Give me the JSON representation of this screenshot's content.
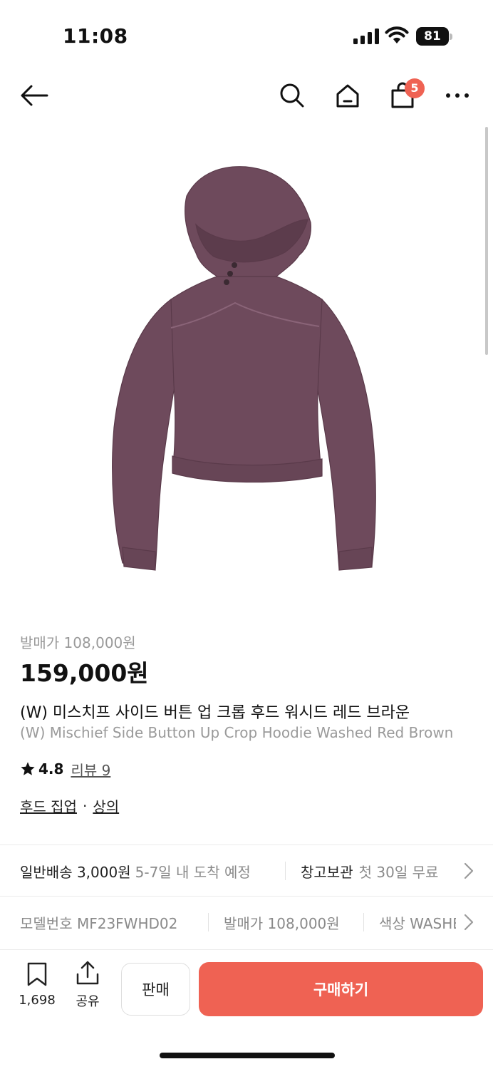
{
  "status": {
    "time": "11:08",
    "battery": "81"
  },
  "nav": {
    "cart_count": "5"
  },
  "product": {
    "release_price_label": "발매가 108,000원",
    "price": "159,000원",
    "name_ko": "(W) 미스치프 사이드 버튼 업 크롭 후드 워시드 레드 브라운",
    "name_en": "(W) Mischief Side Button Up Crop Hoodie Washed Red Brown",
    "rating": "4.8",
    "review_link": "리뷰 9",
    "category_1": "후드 집업",
    "category_sep": "·",
    "category_2": "상의"
  },
  "shipping": {
    "label": "일반배송 3,000원",
    "eta": "5-7일 내 도착 예정",
    "storage_label": "창고보관",
    "storage_note": "첫 30일 무료"
  },
  "specs": {
    "model": "모델번호 MF23FWHD02",
    "release": "발매가 108,000원",
    "color": "색상 WASHED RED BROWN"
  },
  "bottom_bar": {
    "wish_count": "1,698",
    "share_label": "공유",
    "sell_label": "판매",
    "buy_label": "구매하기"
  },
  "colors": {
    "accent": "#ef6253",
    "hoodie": "#6e4a5c"
  }
}
